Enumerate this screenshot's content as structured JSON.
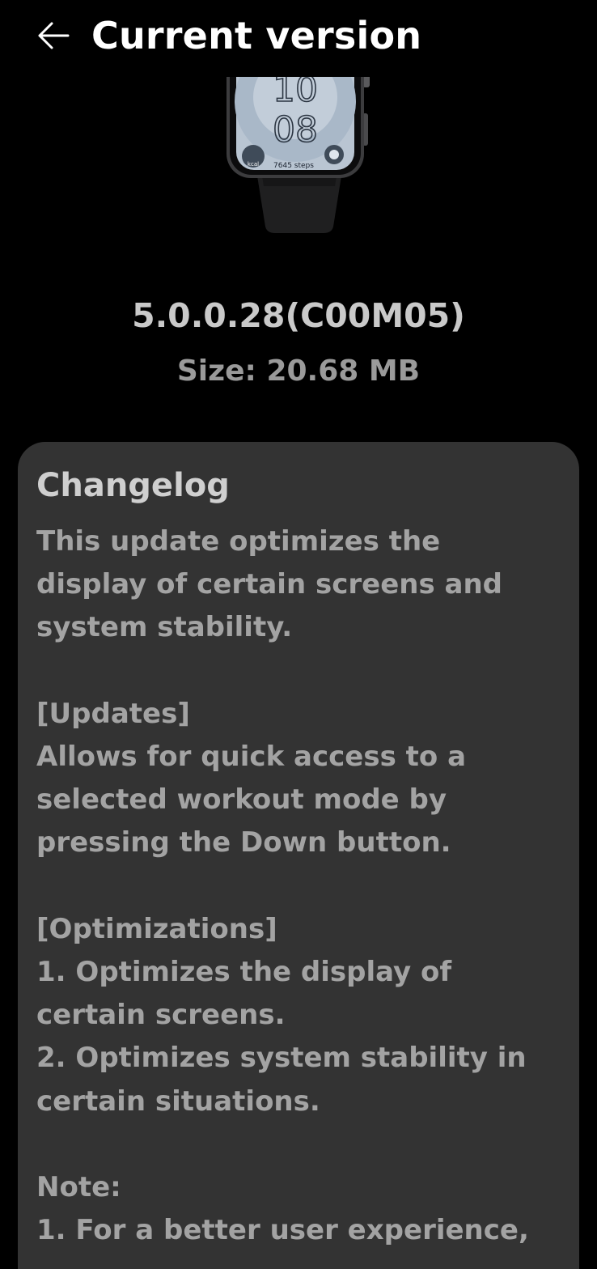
{
  "header": {
    "title": "Current version",
    "back_icon": "back-arrow-icon"
  },
  "device_image": {
    "clock_digits": [
      "10",
      "08"
    ],
    "steps_text": "7645 steps",
    "kcal_text": "kcal"
  },
  "firmware": {
    "version": "5.0.0.28(C00M05)",
    "size": "Size: 20.68 MB"
  },
  "changelog": {
    "title": "Changelog",
    "lines": [
      "This update optimizes the",
      "display of certain screens and",
      "system stability.",
      "",
      "[Updates]",
      "Allows for quick access to a",
      "selected workout mode by",
      "pressing the Down button.",
      "",
      "[Optimizations]",
      "1. Optimizes the display of",
      "certain screens.",
      "2. Optimizes system stability in",
      "certain situations.",
      "",
      "Note:",
      "1. For a better user experience,"
    ]
  },
  "colors": {
    "background": "#000000",
    "card": "#333333",
    "title_text": "#ffffff",
    "body_text": "#a3a3a3"
  }
}
